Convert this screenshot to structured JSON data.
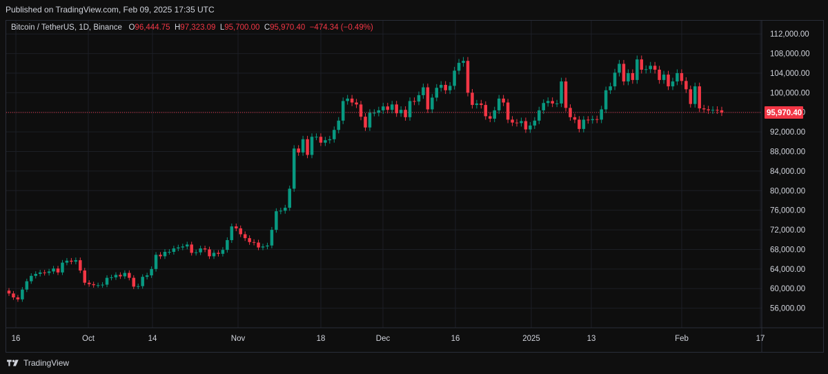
{
  "header": {
    "published": "Published on TradingView.com, Feb 09, 2025 17:35 UTC"
  },
  "legend": {
    "symbol": "Bitcoin / TetherUS, 1D, Binance",
    "o_label": "O",
    "o_value": "96,444.75",
    "h_label": "H",
    "h_value": "97,323.09",
    "l_label": "L",
    "l_value": "95,700.00",
    "c_label": "C",
    "c_value": "95,970.40",
    "change": "−474.34 (−0.49%)"
  },
  "footer": {
    "brand": "TradingView"
  },
  "colors": {
    "up": "#089981",
    "down": "#f23645",
    "grid": "#1c1f26",
    "axis_text": "#d1d4dc",
    "price_line": "#f23645"
  },
  "chart_data": {
    "type": "candlestick",
    "symbol": "BTCUSDT",
    "interval": "1D",
    "exchange": "Binance",
    "x_ticks": [
      "16",
      "Oct",
      "14",
      "Nov",
      "18",
      "Dec",
      "16",
      "2025",
      "13",
      "Feb",
      "17"
    ],
    "y_ticks": [
      "56,000.00",
      "60,000.00",
      "64,000.00",
      "68,000.00",
      "72,000.00",
      "76,000.00",
      "80,000.00",
      "84,000.00",
      "88,000.00",
      "92,000.00",
      "96,000.00",
      "100,000.00",
      "104,000.00",
      "108,000.00",
      "112,000.00"
    ],
    "ylim": [
      52000,
      114000
    ],
    "last_price_label": "95,970.40",
    "last_price": 95970.4,
    "closes": [
      59000,
      58200,
      57800,
      59800,
      61500,
      62600,
      63000,
      63300,
      63200,
      63500,
      64100,
      63300,
      65300,
      65700,
      65500,
      65800,
      63700,
      61200,
      60900,
      60700,
      60700,
      60800,
      62200,
      62300,
      62800,
      62500,
      63200,
      62200,
      60400,
      60500,
      62400,
      62700,
      64000,
      66900,
      66600,
      67500,
      67500,
      68200,
      68400,
      68600,
      69000,
      67300,
      67400,
      68200,
      68000,
      66600,
      67300,
      67100,
      67900,
      69900,
      72700,
      72300,
      71100,
      70300,
      69500,
      69400,
      68400,
      68600,
      68800,
      72000,
      75800,
      75900,
      76500,
      80400,
      88600,
      87800,
      90500,
      87300,
      91000,
      91000,
      89800,
      90300,
      90500,
      92400,
      94300,
      98300,
      98800,
      98000,
      97600,
      95100,
      92900,
      95900,
      95900,
      96400,
      97200,
      96500,
      97600,
      95800,
      96500,
      95000,
      98300,
      98200,
      99500,
      101100,
      96600,
      99000,
      101000,
      101600,
      100500,
      101400,
      104500,
      106100,
      106500,
      100000,
      97500,
      97800,
      97500,
      95200,
      94700,
      96400,
      98800,
      98000,
      94500,
      93900,
      93800,
      94200,
      92500,
      93300,
      94300,
      96400,
      97900,
      98300,
      97800,
      97800,
      102300,
      96900,
      95000,
      94500,
      92600,
      94500,
      94400,
      94600,
      94500,
      96600,
      100500,
      101300,
      104100,
      105900,
      102300,
      104000,
      102600,
      106800,
      104700,
      104800,
      105500,
      104700,
      102600,
      103700,
      101300,
      102300,
      104000,
      102400,
      100700,
      97700,
      101300,
      96800,
      96600,
      96400,
      96500,
      96400,
      95970.4
    ]
  }
}
